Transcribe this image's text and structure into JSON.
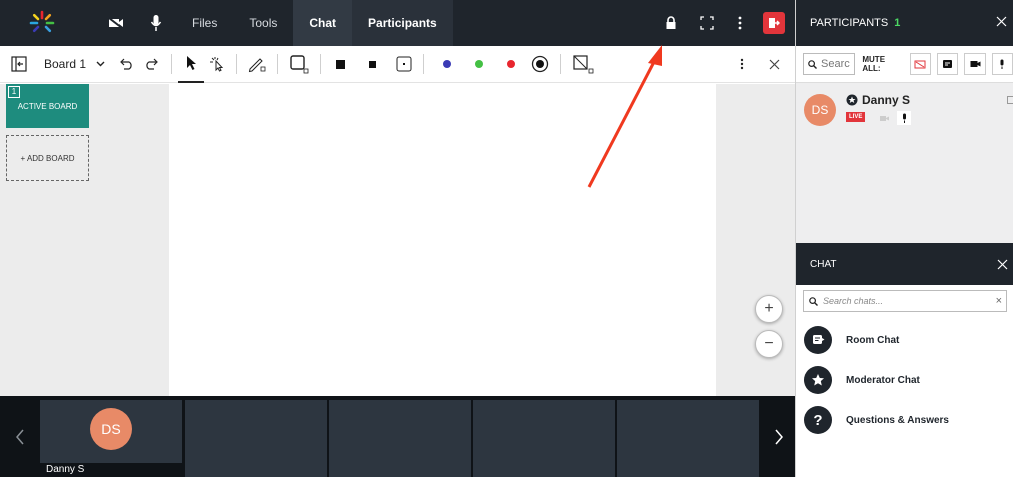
{
  "topbar": {
    "nav": [
      "Files",
      "Tools",
      "Chat",
      "Participants"
    ],
    "icons": [
      "camera-off-icon",
      "microphone-icon",
      "lock-icon",
      "fullscreen-icon",
      "more-vertical-icon",
      "exit-icon"
    ],
    "accent_colors": [
      "#e2353b",
      "#1e8c7e"
    ]
  },
  "toolbar": {
    "board_label": "Board 1",
    "color_dots": [
      "#3b3bb5",
      "#44c044",
      "#e8262e"
    ]
  },
  "boards": {
    "active_number": "1",
    "active_label": "ACTIVE BOARD",
    "add_label": "+ ADD BOARD"
  },
  "zoom": {
    "in": "+",
    "out": "−"
  },
  "strip": {
    "tile_initials": "DS",
    "tile_name": "Danny S"
  },
  "participants_panel": {
    "title": "PARTICIPANTS",
    "count": "1",
    "search_placeholder": "Searc",
    "mute_all_label": "MUTE ALL:",
    "participant": {
      "initials": "DS",
      "name": "Danny S",
      "badge": "LIVE"
    }
  },
  "chat_panel": {
    "title": "CHAT",
    "search_placeholder": "Search chats...",
    "items": [
      "Room Chat",
      "Moderator Chat",
      "Questions & Answers"
    ]
  }
}
